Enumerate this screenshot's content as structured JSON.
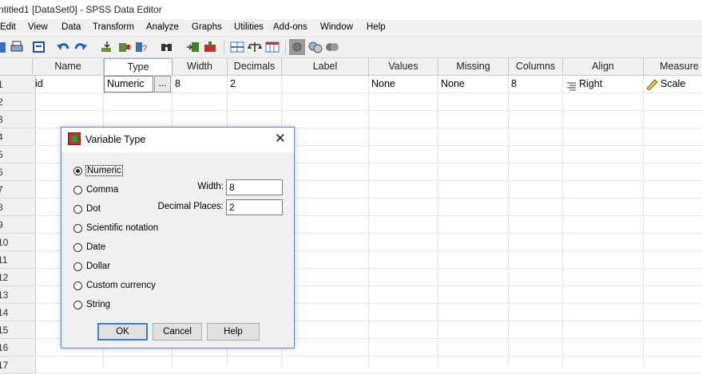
{
  "window": {
    "title": "ntitled1 [DataSet0] - SPSS Data Editor"
  },
  "menu": {
    "items": [
      "Edit",
      "View",
      "Data",
      "Transform",
      "Analyze",
      "Graphs",
      "Utilities",
      "Add-ons",
      "Window",
      "Help"
    ]
  },
  "grid": {
    "columns": [
      "Name",
      "Type",
      "Width",
      "Decimals",
      "Label",
      "Values",
      "Missing",
      "Columns",
      "Align",
      "Measure"
    ],
    "row1": {
      "name": "id",
      "type": "Numeric",
      "ellipsis": "...",
      "width": "8",
      "decimals": "2",
      "label": "",
      "values": "None",
      "missing": "None",
      "columns": "8",
      "align": "Right",
      "measure": "Scale"
    },
    "row_numbers": [
      "1",
      "2",
      "3",
      "4",
      "5",
      "6",
      "7",
      "8",
      "9",
      "10",
      "11",
      "12",
      "13",
      "14",
      "15",
      "16",
      "17"
    ]
  },
  "dialog": {
    "title": "Variable Type",
    "close_glyph": "✕",
    "options": [
      "Numeric",
      "Comma",
      "Dot",
      "Scientific notation",
      "Date",
      "Dollar",
      "Custom currency",
      "String"
    ],
    "selected": "Numeric",
    "width_label": "Width:",
    "width_value": "8",
    "decimals_label": "Decimal Places:",
    "decimals_value": "2",
    "buttons": {
      "ok": "OK",
      "cancel": "Cancel",
      "help": "Help"
    }
  },
  "icons": {
    "toolbar": [
      "open-data-icon",
      "print-icon",
      "dialog-recall-icon",
      "undo-icon",
      "redo-icon",
      "goto-case-icon",
      "goto-variable-icon",
      "variables-icon",
      "find-icon",
      "insert-cases-icon",
      "insert-variable-icon",
      "split-file-icon",
      "weight-cases-icon",
      "select-cases-icon",
      "value-labels-icon",
      "use-sets-icon",
      "show-all-variables-icon"
    ],
    "align": "align-right-icon",
    "measure": "scale-ruler-icon"
  },
  "colors": {
    "accent": "#3c7fd1",
    "dialog_border": "#5b8fc7"
  }
}
